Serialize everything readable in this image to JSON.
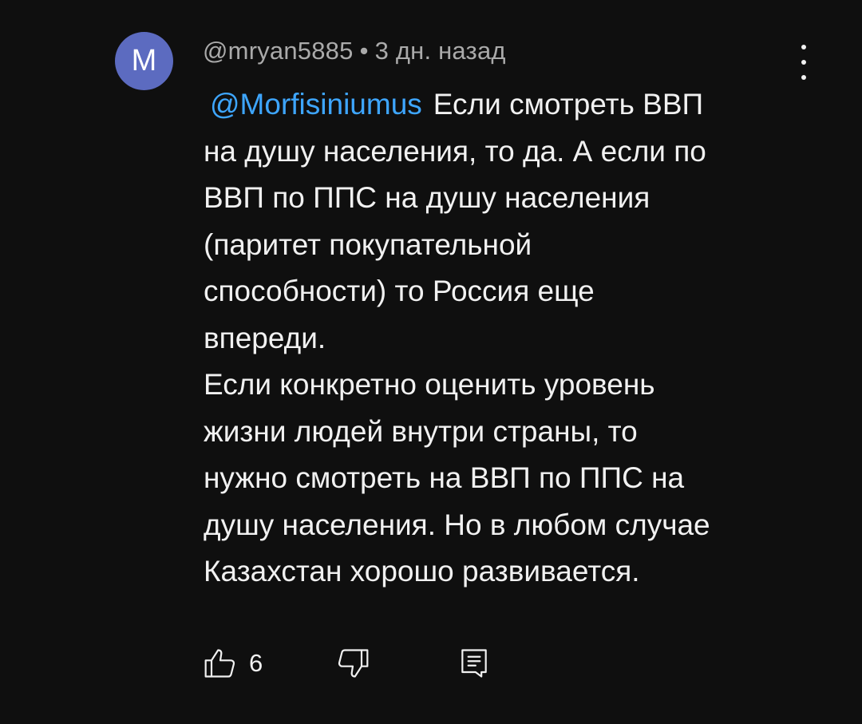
{
  "comment": {
    "avatar_letter": "M",
    "avatar_color": "#5c6bc0",
    "author": "@mryan5885",
    "separator": "•",
    "timestamp": "3 дн. назад",
    "mention": "@Morfisiniumus",
    "mention_color": "#3ea6ff",
    "lines": [
      "Если смотреть ВВП",
      "на душу населения, то да. А если по",
      "ВВП по ППС на душу населения",
      "(паритет покупательной",
      "способности) то Россия еще",
      "впереди.",
      "Если конкретно оценить уровень",
      "жизни людей внутри страны, то",
      "нужно смотреть на ВВП по ППС на",
      "душу населения. Но в любом случае",
      "Казахстан хорошо развивается."
    ],
    "like_count": "6",
    "icons": {
      "menu": "more-vertical-icon",
      "like": "thumbs-up-icon",
      "dislike": "thumbs-down-icon",
      "reply": "reply-comment-icon"
    }
  }
}
